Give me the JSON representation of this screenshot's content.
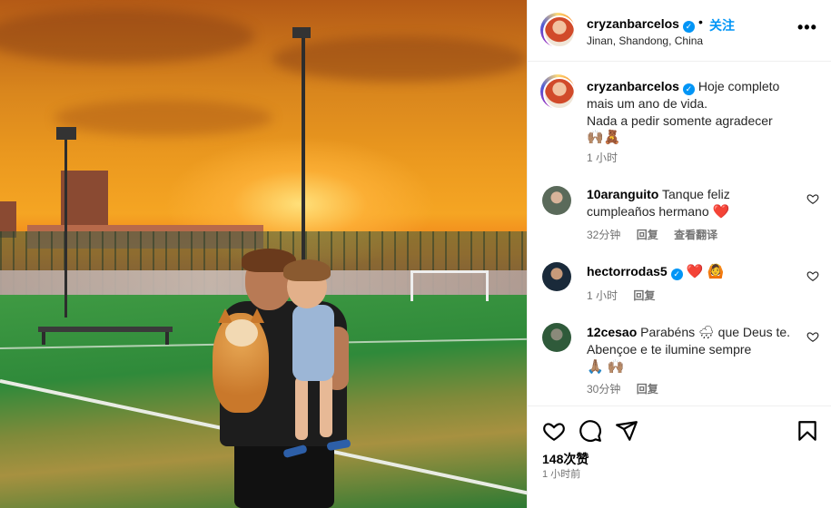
{
  "post": {
    "header": {
      "username": "cryzanbarcelos",
      "verified_mark": "✓",
      "separator": "•",
      "follow_label": "关注",
      "location": "Jinan, Shandong, China",
      "more_label": "•••"
    },
    "caption": {
      "username": "cryzanbarcelos",
      "line1": "Hoje completo",
      "line2": "mais um ano de vida.",
      "line3": "Nada a pedir somente agradecer",
      "emoji": "🙌🏽🧸",
      "time": "1 小时"
    },
    "comments": [
      {
        "username": "10aranguito",
        "text": "Tanque feliz cumpleaños hermano",
        "emoji": "❤️",
        "time": "32分钟",
        "reply_label": "回复",
        "translate_label": "查看翻译"
      },
      {
        "username": "hectorrodas5",
        "text": "",
        "emoji": "❤️ 🙆",
        "time": "1 小时",
        "reply_label": "回复"
      },
      {
        "username": "12cesao",
        "text": "Parabéns 🌧 que Deus te. Abençoe e te ilumine sempre",
        "emoji": "🙏🏽 🙌🏽",
        "time": "30分钟",
        "reply_label": "回复"
      }
    ],
    "actions": {
      "icons": [
        "heart-icon",
        "comment-icon",
        "share-icon",
        "bookmark-icon"
      ],
      "likes": "148次赞",
      "time_ago": "1 小时前"
    }
  },
  "colors": {
    "accent": "#0095f6",
    "muted": "#737373",
    "heart_red": "#ed4956"
  }
}
